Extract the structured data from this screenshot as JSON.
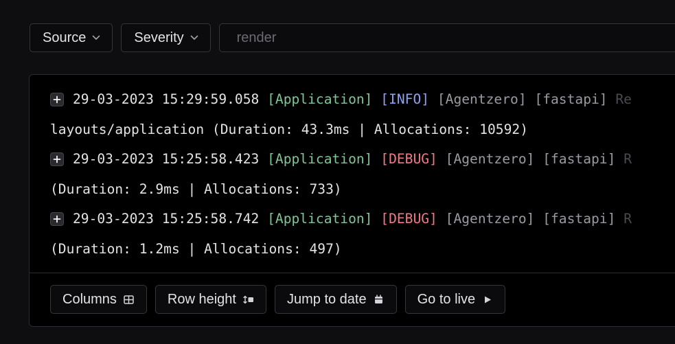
{
  "filters": {
    "source": {
      "label": "Source",
      "icon": "chevron-down-icon"
    },
    "severity": {
      "label": "Severity",
      "icon": "chevron-down-icon"
    },
    "search": {
      "value": "",
      "placeholder": "render",
      "icon": "search-icon"
    }
  },
  "log": {
    "entries": [
      {
        "timestamp": "29-03-2023 15:29:59.058",
        "source": "[Application]",
        "level": "[INFO]",
        "tag1": "[Agentzero]",
        "tag2": "[fastapi]",
        "message_start": "Re",
        "continuation": "layouts/application (Duration: 43.3ms | Allocations: 10592)"
      },
      {
        "timestamp": "29-03-2023 15:25:58.423",
        "source": "[Application]",
        "level": "[DEBUG]",
        "tag1": "[Agentzero]",
        "tag2": "[fastapi]",
        "message_start": "R",
        "continuation": "(Duration: 2.9ms | Allocations: 733)"
      },
      {
        "timestamp": "29-03-2023 15:25:58.742",
        "source": "[Application]",
        "level": "[DEBUG]",
        "tag1": "[Agentzero]",
        "tag2": "[fastapi]",
        "message_start": "R",
        "continuation": "(Duration: 1.2ms | Allocations: 497)"
      }
    ]
  },
  "toolbar": {
    "columns_label": "Columns",
    "row_height_label": "Row height",
    "jump_to_date_label": "Jump to date",
    "go_to_live_label": "Go to live"
  },
  "colors": {
    "background": "#0e0e10",
    "panel": "#000000",
    "source_green": "#7fc796",
    "info_blue": "#8ea3f0",
    "debug_red": "#f07a86",
    "tag_gray": "#9a9aa3"
  }
}
